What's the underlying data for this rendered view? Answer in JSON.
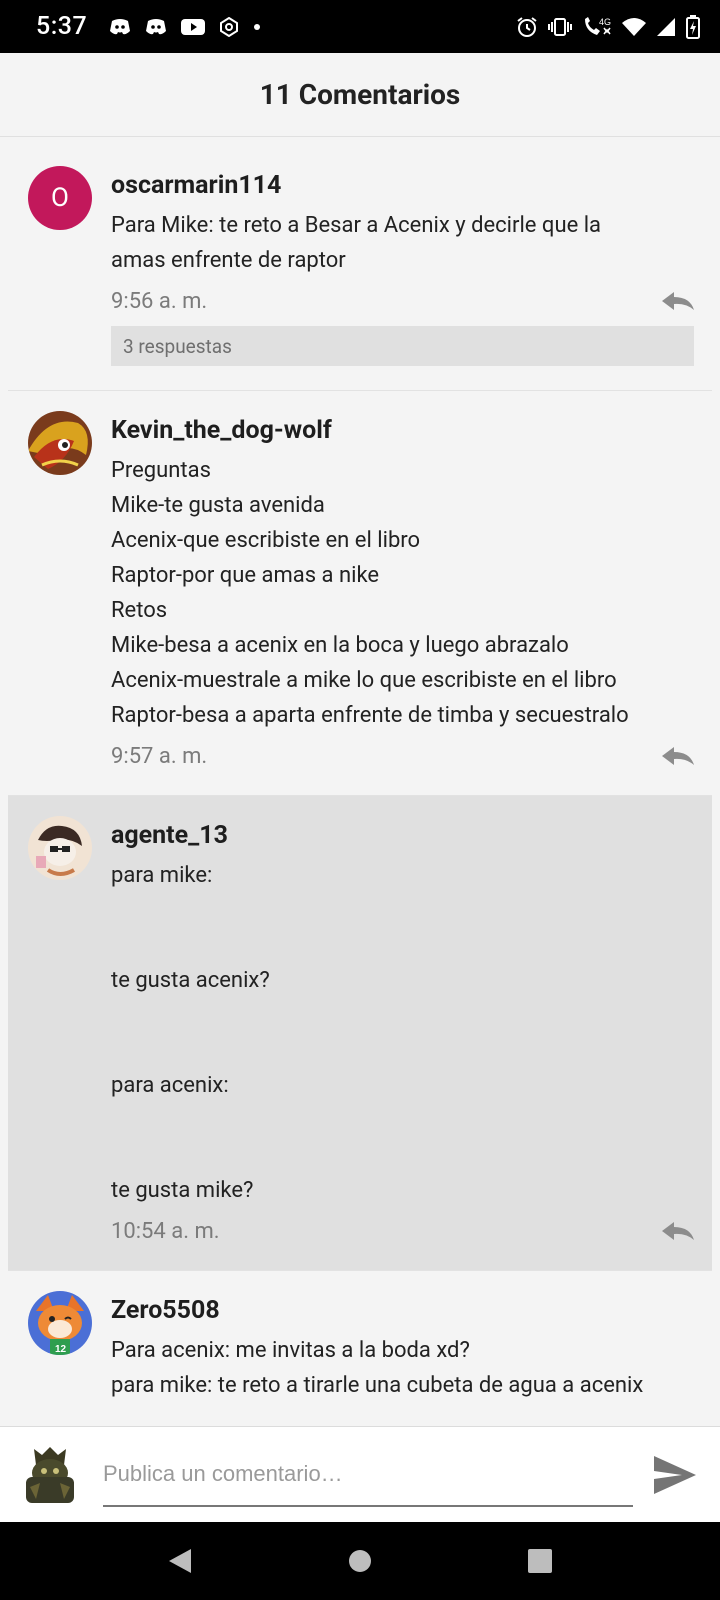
{
  "status_bar": {
    "time": "5:37",
    "left_icons": [
      "discord-icon",
      "discord-icon",
      "youtube-icon",
      "sticker-icon",
      "dot-icon"
    ],
    "right_icons": [
      "alarm-icon",
      "vibrate-icon",
      "wifi-calling-icon",
      "wifi-icon",
      "signal-icon",
      "battery-charging-icon"
    ],
    "network_label": "4G"
  },
  "header": {
    "title": "11 Comentarios"
  },
  "comments": [
    {
      "avatar_letter": "O",
      "username": "oscarmarin114",
      "lines": [
        "Para Mike: te reto a Besar a Acenix y decirle que la",
        "amas enfrente de raptor"
      ],
      "time": "9:56 a. m.",
      "replies": "3 respuestas"
    },
    {
      "username": "Kevin_the_dog-wolf",
      "lines": [
        "Preguntas",
        "Mike-te gusta avenida",
        "Acenix-que escribiste en el libro",
        "Raptor-por que amas a nike",
        "Retos",
        "Mike-besa a acenix en la boca y luego abrazalo",
        "Acenix-muestrale a mike lo que escribiste en el libro",
        "Raptor-besa a aparta enfrente de timba y secuestralo"
      ],
      "time": "9:57 a. m."
    },
    {
      "username": "agente_13",
      "lines": [
        "para mike:",
        "",
        "",
        "te gusta acenix?",
        "",
        "",
        "para acenix:",
        "",
        "",
        "te gusta mike?"
      ],
      "time": "10:54 a. m."
    },
    {
      "username": "Zero5508",
      "lines": [
        "Para acenix: me invitas a la boda xd?",
        "para mike: te reto a tirarle una cubeta de agua a acenix"
      ]
    }
  ],
  "composer": {
    "placeholder": "Publica un comentario…"
  },
  "colors": {
    "avatar_letter_bg": "#c2185b",
    "highlight_bg": "#e0e0e0",
    "background": "#f4f4f4"
  }
}
